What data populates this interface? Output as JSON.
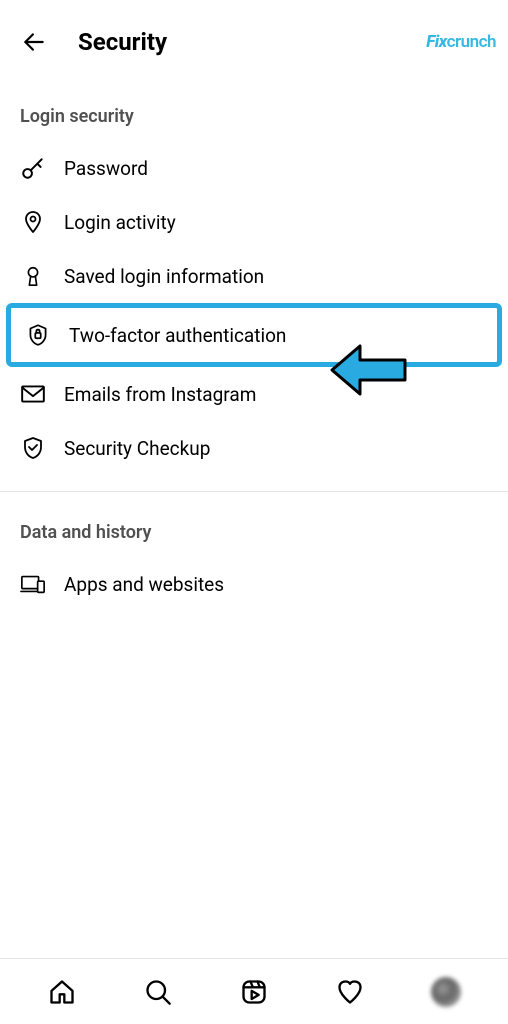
{
  "header": {
    "title": "Security",
    "watermark_fix": "Fix",
    "watermark_crunch": "crunch"
  },
  "sections": {
    "login_security_label": "Login security",
    "data_history_label": "Data and history"
  },
  "items": {
    "password": "Password",
    "login_activity": "Login activity",
    "saved_login": "Saved login information",
    "two_factor": "Two-factor authentication",
    "emails": "Emails from Instagram",
    "security_checkup": "Security Checkup",
    "apps_websites": "Apps and websites"
  }
}
